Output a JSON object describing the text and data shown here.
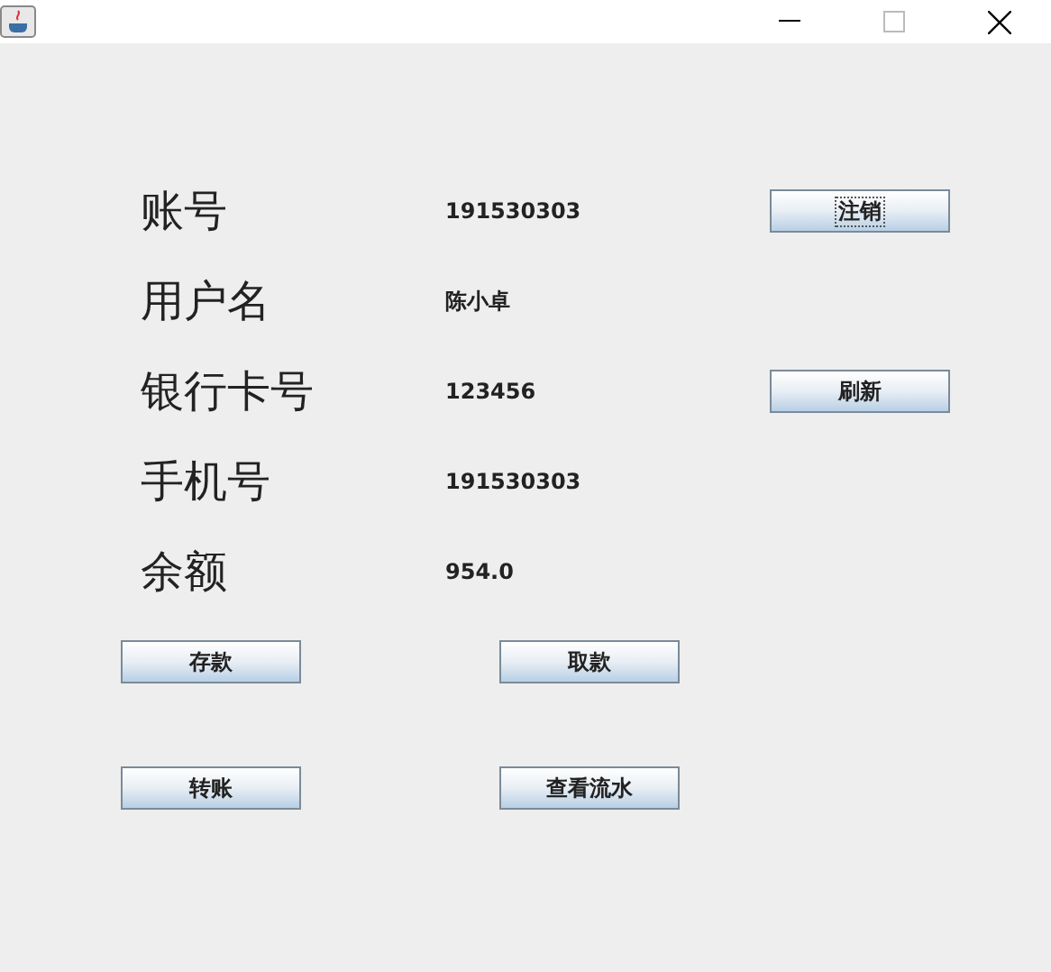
{
  "fields": [
    {
      "label": "账号",
      "value": "191530303",
      "button": {
        "label": "注销",
        "focused": true
      }
    },
    {
      "label": "用户名",
      "value": "陈小卓"
    },
    {
      "label": "银行卡号",
      "value": "123456",
      "button": {
        "label": "刷新",
        "focused": false
      }
    },
    {
      "label": "手机号",
      "value": "191530303"
    },
    {
      "label": "余额",
      "value": "954.0"
    }
  ],
  "actions": [
    [
      {
        "label": "存款",
        "focused": false
      },
      {
        "label": "取款",
        "focused": false
      }
    ],
    [
      {
        "label": "转账",
        "focused": false
      },
      {
        "label": "查看流水",
        "focused": false
      }
    ]
  ]
}
